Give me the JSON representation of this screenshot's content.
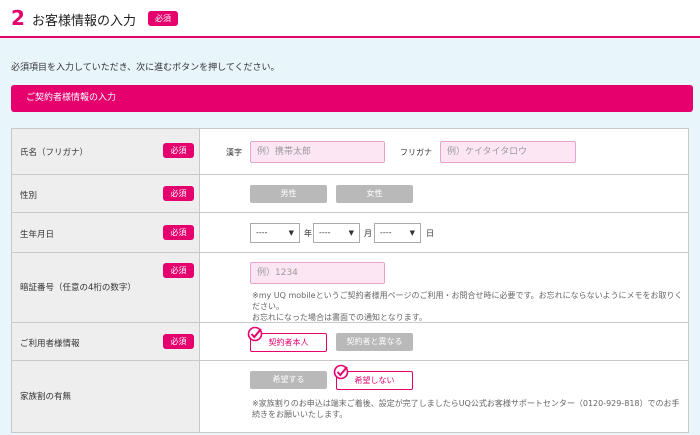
{
  "step": {
    "number": "2",
    "title": "お客様情報の入力",
    "badge": "必須"
  },
  "instruction": "必須項目を入力していただき、次に進むボタンを押してください。",
  "section": {
    "title": "ご契約者様情報の入力"
  },
  "badge_label": "必須",
  "rows": {
    "name": {
      "label": "氏名（フリガナ）",
      "kanji_label": "漢字",
      "kanji_placeholder": "例）携帯太郎",
      "kana_label": "フリガナ",
      "kana_placeholder": "例）ケイタイタロウ"
    },
    "gender": {
      "label": "性別",
      "male": "男性",
      "female": "女性"
    },
    "birth": {
      "label": "生年月日",
      "year_value": "----",
      "year_unit": "年",
      "month_value": "----",
      "month_unit": "月",
      "day_value": "----",
      "day_unit": "日"
    },
    "pin": {
      "label": "暗証番号（任意の4桁の数字）",
      "placeholder": "例）1234",
      "note1": "※my UQ mobileというご契約者様用ページのご利用・お問合せ時に必要です。お忘れにならないようにメモをお取りください。",
      "note2": "お忘れになった場合は書面での通知となります。"
    },
    "user": {
      "label": "ご利用者様情報",
      "self": "契約者本人",
      "other": "契約者と異なる"
    },
    "family": {
      "label": "家族割の有無",
      "yes": "希望する",
      "no": "希望しない",
      "note": "※家族割りのお申込は端末ご着後、設定が完了しましたらUQ公式お客様サポートセンター（0120-929-818）でのお手続きをお願いいたします。"
    }
  },
  "colors": {
    "accent": "#e5006e",
    "background": "#e8f6fc",
    "input_bg": "#fde6f3",
    "gray_button": "#b9b9b9"
  },
  "icons": {
    "check": "checkmark-circle-icon",
    "dropdown": "triangle-down-icon"
  }
}
